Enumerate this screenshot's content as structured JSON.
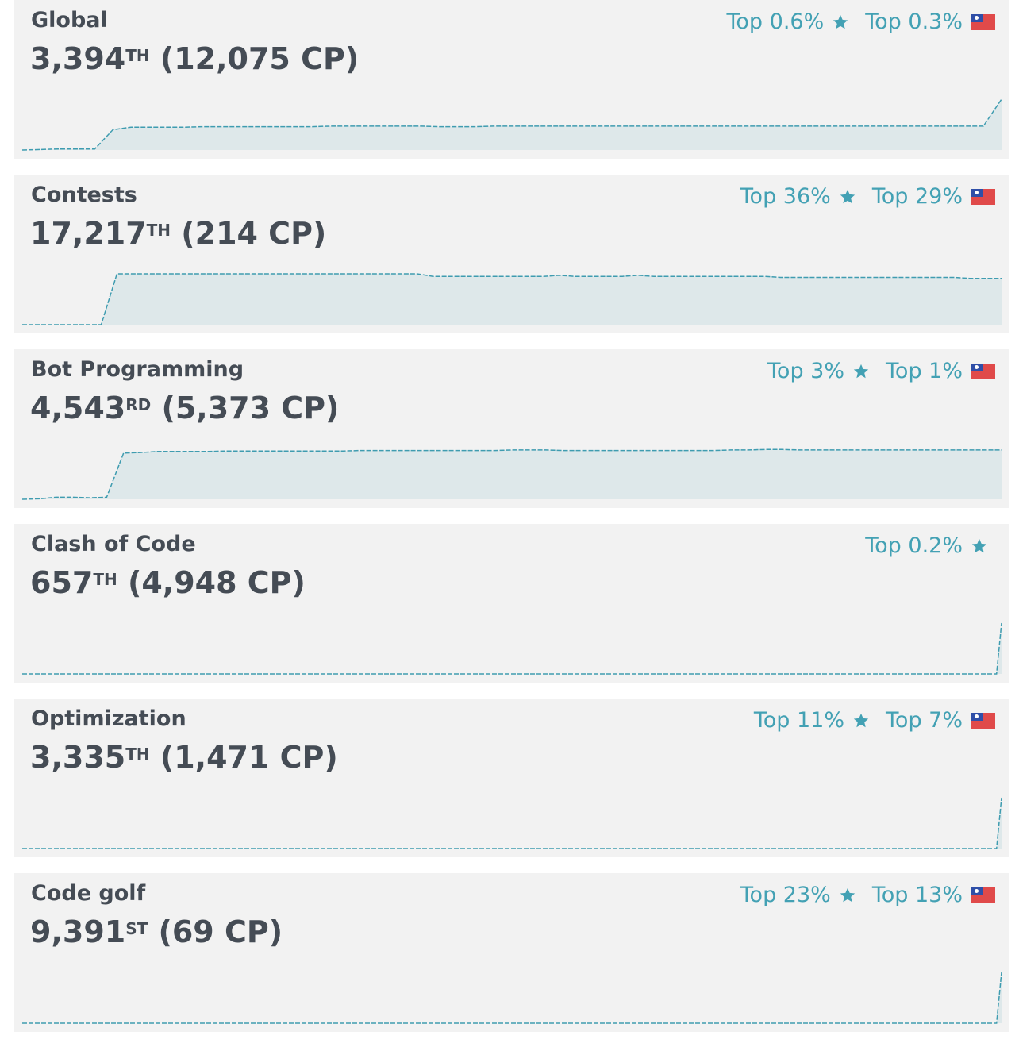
{
  "colors": {
    "accent": "#43a1b4",
    "line": "#3f9cb0",
    "fill": "#dee8ea",
    "text": "#454c55",
    "card": "#f2f2f2"
  },
  "cards": [
    {
      "title": "Global",
      "rank": "3,394",
      "suffix": "TH",
      "points": "(12,075 CP)",
      "world_top": "Top 0.6%",
      "country_top": "Top 0.3%",
      "trend": [
        0.0,
        0.01,
        0.02,
        0.02,
        0.02,
        0.4,
        0.45,
        0.45,
        0.45,
        0.45,
        0.46,
        0.46,
        0.46,
        0.46,
        0.46,
        0.46,
        0.46,
        0.47,
        0.47,
        0.47,
        0.47,
        0.47,
        0.47,
        0.46,
        0.46,
        0.46,
        0.47,
        0.47,
        0.47,
        0.47,
        0.47,
        0.47,
        0.47,
        0.47,
        0.47,
        0.47,
        0.47,
        0.47,
        0.47,
        0.47,
        0.47,
        0.47,
        0.47,
        0.47,
        0.47,
        0.47,
        0.47,
        0.47,
        0.47,
        0.47,
        0.47,
        0.47,
        0.47,
        0.47,
        1.0
      ]
    },
    {
      "title": "Contests",
      "rank": "17,217",
      "suffix": "TH",
      "points": "(214 CP)",
      "world_top": "Top 36%",
      "country_top": "Top 29%",
      "trend": [
        0.0,
        0.0,
        0.0,
        0.0,
        0.0,
        0.0,
        1.0,
        1.0,
        1.0,
        1.0,
        1.0,
        1.0,
        1.0,
        1.0,
        1.0,
        1.0,
        1.0,
        1.0,
        1.0,
        1.0,
        1.0,
        1.0,
        1.0,
        1.0,
        1.0,
        1.0,
        0.95,
        0.95,
        0.95,
        0.95,
        0.95,
        0.95,
        0.95,
        0.95,
        0.97,
        0.95,
        0.95,
        0.95,
        0.95,
        0.97,
        0.95,
        0.95,
        0.95,
        0.95,
        0.95,
        0.95,
        0.95,
        0.95,
        0.93,
        0.93,
        0.93,
        0.93,
        0.93,
        0.93,
        0.93,
        0.93,
        0.93,
        0.93,
        0.93,
        0.93,
        0.91,
        0.91,
        0.91
      ]
    },
    {
      "title": "Bot Programming",
      "rank": "4,543",
      "suffix": "RD",
      "points": "(5,373 CP)",
      "world_top": "Top 3%",
      "country_top": "Top 1%",
      "trend": [
        0.0,
        0.01,
        0.04,
        0.04,
        0.03,
        0.04,
        0.91,
        0.92,
        0.94,
        0.94,
        0.94,
        0.94,
        0.95,
        0.95,
        0.95,
        0.95,
        0.95,
        0.95,
        0.95,
        0.95,
        0.96,
        0.96,
        0.96,
        0.96,
        0.96,
        0.96,
        0.96,
        0.96,
        0.96,
        0.97,
        0.97,
        0.97,
        0.96,
        0.96,
        0.96,
        0.96,
        0.96,
        0.96,
        0.96,
        0.96,
        0.96,
        0.96,
        0.97,
        0.97,
        0.98,
        0.98,
        0.97,
        0.97,
        0.97,
        0.97,
        0.97,
        0.97,
        0.97,
        0.97,
        0.97,
        0.97,
        0.97,
        0.97,
        0.97
      ]
    },
    {
      "title": "Clash of Code",
      "rank": "657",
      "suffix": "TH",
      "points": "(4,948 CP)",
      "world_top": "Top 0.2%",
      "country_top": "",
      "trend": [
        0,
        0,
        0,
        0,
        0,
        0,
        0,
        0,
        0,
        0,
        0,
        0,
        0,
        0,
        0,
        0,
        0,
        0,
        0,
        0,
        0,
        0,
        0,
        0,
        0,
        0,
        0,
        0,
        0,
        0,
        0,
        0,
        0,
        0,
        0,
        0,
        0,
        0,
        0,
        0,
        0,
        0,
        0,
        0,
        0,
        0,
        0,
        0,
        0,
        0,
        0,
        0,
        0,
        0,
        0,
        0,
        0,
        0,
        0,
        0,
        0,
        0,
        0,
        0,
        0,
        0,
        0,
        0,
        0,
        0,
        0,
        0,
        0,
        0,
        0,
        0,
        0,
        0,
        0,
        0,
        0,
        0,
        0,
        0,
        0,
        0,
        0,
        0,
        0,
        0,
        0,
        0,
        0,
        0,
        0,
        0,
        0,
        0,
        0,
        0,
        0,
        0,
        0,
        0,
        0,
        0,
        0,
        0,
        0,
        0,
        0,
        0,
        0,
        0,
        0,
        0,
        0,
        0,
        0,
        0,
        0,
        0,
        0,
        0,
        0,
        0,
        0,
        0,
        0,
        0,
        0,
        0,
        0,
        0,
        0,
        0,
        0,
        0,
        0,
        0,
        0,
        0,
        0,
        0,
        0,
        0,
        0,
        0,
        0,
        0,
        0,
        0,
        0,
        0,
        0,
        0,
        0,
        0,
        0,
        0,
        0,
        0,
        0,
        0,
        0,
        0,
        0,
        0,
        0,
        0,
        0,
        0,
        0,
        0,
        0,
        0,
        0,
        0,
        0,
        0,
        0,
        0,
        0,
        0,
        0,
        0,
        0,
        0,
        0,
        0,
        0,
        0,
        0,
        0,
        0,
        0,
        1
      ]
    },
    {
      "title": "Optimization",
      "rank": "3,335",
      "suffix": "TH",
      "points": "(1,471 CP)",
      "world_top": "Top 11%",
      "country_top": "Top 7%",
      "trend": [
        0,
        0,
        0,
        0,
        0,
        0,
        0,
        0,
        0,
        0,
        0,
        0,
        0,
        0,
        0,
        0,
        0,
        0,
        0,
        0,
        0,
        0,
        0,
        0,
        0,
        0,
        0,
        0,
        0,
        0,
        0,
        0,
        0,
        0,
        0,
        0,
        0,
        0,
        0,
        0,
        0,
        0,
        0,
        0,
        0,
        0,
        0,
        0,
        0,
        0,
        0,
        0,
        0,
        0,
        0,
        0,
        0,
        0,
        0,
        0,
        0,
        0,
        0,
        0,
        0,
        0,
        0,
        0,
        0,
        0,
        0,
        0,
        0,
        0,
        0,
        0,
        0,
        0,
        0,
        0,
        0,
        0,
        0,
        0,
        0,
        0,
        0,
        0,
        0,
        0,
        0,
        0,
        0,
        0,
        0,
        0,
        0,
        0,
        0,
        0,
        0,
        0,
        0,
        0,
        0,
        0,
        0,
        0,
        0,
        0,
        0,
        0,
        0,
        0,
        0,
        0,
        0,
        0,
        0,
        0,
        0,
        0,
        0,
        0,
        0,
        0,
        0,
        0,
        0,
        0,
        0,
        0,
        0,
        0,
        0,
        0,
        0,
        0,
        0,
        0,
        0,
        0,
        0,
        0,
        0,
        0,
        0,
        0,
        0,
        0,
        0,
        0,
        0,
        0,
        0,
        0,
        0,
        0,
        0,
        0,
        0,
        0,
        0,
        0,
        0,
        0,
        0,
        0,
        0,
        0,
        0,
        0,
        0,
        0,
        0,
        0,
        0,
        0,
        0,
        0,
        0,
        0,
        0,
        0,
        0,
        0,
        0,
        0,
        0,
        0,
        0,
        0,
        0,
        0,
        0,
        0,
        1
      ]
    },
    {
      "title": "Code golf",
      "rank": "9,391",
      "suffix": "ST",
      "points": "(69 CP)",
      "world_top": "Top 23%",
      "country_top": "Top 13%",
      "trend": [
        0,
        0,
        0,
        0,
        0,
        0,
        0,
        0,
        0,
        0,
        0,
        0,
        0,
        0,
        0,
        0,
        0,
        0,
        0,
        0,
        0,
        0,
        0,
        0,
        0,
        0,
        0,
        0,
        0,
        0,
        0,
        0,
        0,
        0,
        0,
        0,
        0,
        0,
        0,
        0,
        0,
        0,
        0,
        0,
        0,
        0,
        0,
        0,
        0,
        0,
        0,
        0,
        0,
        0,
        0,
        0,
        0,
        0,
        0,
        0,
        0,
        0,
        0,
        0,
        0,
        0,
        0,
        0,
        0,
        0,
        0,
        0,
        0,
        0,
        0,
        0,
        0,
        0,
        0,
        0,
        0,
        0,
        0,
        0,
        0,
        0,
        0,
        0,
        0,
        0,
        0,
        0,
        0,
        0,
        0,
        0,
        0,
        0,
        0,
        0,
        0,
        0,
        0,
        0,
        0,
        0,
        0,
        0,
        0,
        0,
        0,
        0,
        0,
        0,
        0,
        0,
        0,
        0,
        0,
        0,
        0,
        0,
        0,
        0,
        0,
        0,
        0,
        0,
        0,
        0,
        0,
        0,
        0,
        0,
        0,
        0,
        0,
        0,
        0,
        0,
        0,
        0,
        0,
        0,
        0,
        0,
        0,
        0,
        0,
        0,
        0,
        0,
        0,
        0,
        0,
        0,
        0,
        0,
        0,
        0,
        0,
        0,
        0,
        0,
        0,
        0,
        0,
        0,
        0,
        0,
        0,
        0,
        0,
        0,
        0,
        0,
        0,
        0,
        0,
        0,
        0,
        0,
        0,
        0,
        0,
        0,
        0,
        0,
        0,
        0,
        0,
        0,
        0,
        0,
        0,
        0,
        1
      ]
    }
  ]
}
